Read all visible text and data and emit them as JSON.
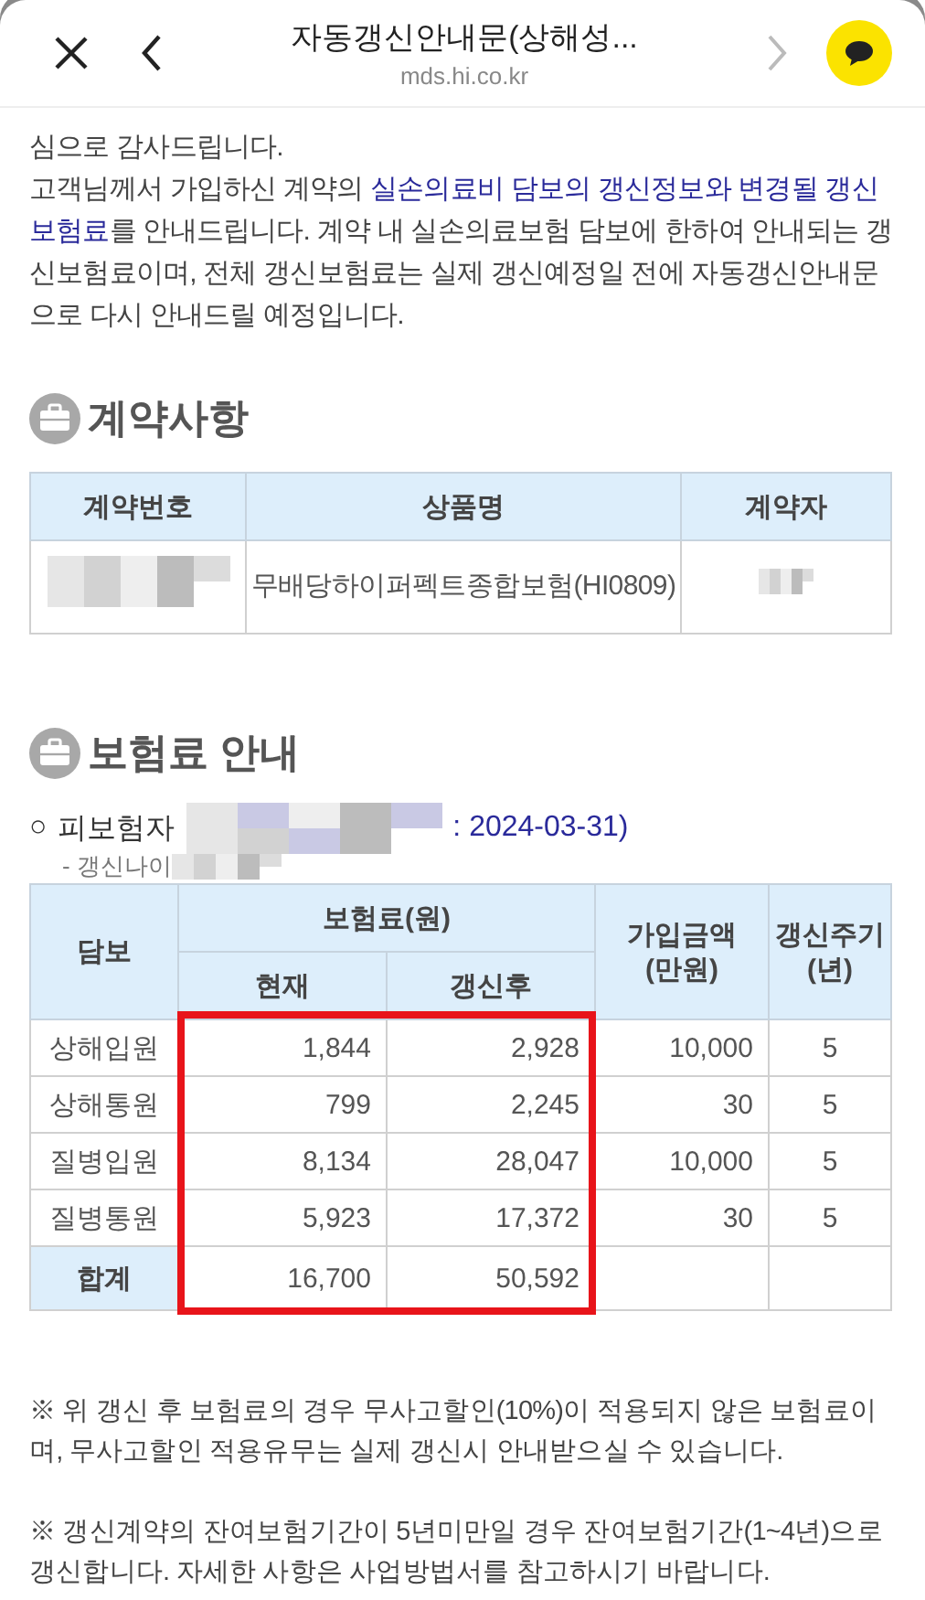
{
  "browser_bar": {
    "title": "자동갱신안내문(상해성...",
    "url": "mds.hi.co.kr"
  },
  "intro": [
    {
      "segments": [
        {
          "text": "심으로 감사드립니다.",
          "highlight": false
        }
      ]
    },
    {
      "segments": [
        {
          "text": "고객님께서 가입하신 계약의 ",
          "highlight": false
        },
        {
          "text": "실손의료비 담보의 갱신정보와 변경될 갱신보험료",
          "highlight": true
        },
        {
          "text": "를 안내드립니다. 계약 내 실손의료보험 담보에 한하여 안내되는 갱신보험료이며, 전체 갱신보험료는 실제 갱신예정일 전에 자동갱신안내문으로 다시 안내드릴 예정입니다.",
          "highlight": false
        }
      ]
    }
  ],
  "contract": {
    "title": "계약사항",
    "columns": [
      "계약번호",
      "상품명",
      "계약자"
    ],
    "row": [
      {
        "kind": "redacted"
      },
      {
        "kind": "text",
        "text": "무배당하이퍼펙트종합보험(HI0809)"
      },
      {
        "kind": "redacted"
      }
    ]
  },
  "premium": {
    "title": "보험료 안내",
    "bullet": "○",
    "insured_label": "피보험자",
    "insured_tail": ": 2024-03-31)",
    "sub_line": "- 갱신나이",
    "table": {
      "columns": {
        "coverage": "담보",
        "premium": "보험료(원)",
        "current": "현재",
        "renewed": "갱신후",
        "amount": "가입금액\n(만원)",
        "cycle": "갱신주기\n(년)"
      },
      "rows": [
        {
          "coverage": "상해입원",
          "current": "1,844",
          "renewed": "2,928",
          "amount": "10,000",
          "cycle": "5"
        },
        {
          "coverage": "상해통원",
          "current": "799",
          "renewed": "2,245",
          "amount": "30",
          "cycle": "5"
        },
        {
          "coverage": "질병입원",
          "current": "8,134",
          "renewed": "28,047",
          "amount": "10,000",
          "cycle": "5"
        },
        {
          "coverage": "질병통원",
          "current": "5,923",
          "renewed": "17,372",
          "amount": "30",
          "cycle": "5"
        }
      ],
      "total": {
        "coverage": "합계",
        "current": "16,700",
        "renewed": "50,592"
      },
      "highlighted": true
    }
  },
  "notes": [
    "※ 위 갱신 후 보험료의 경우 무사고할인(10%)이 적용되지 않은 보험료이며, 무사고할인 적용유무는 실제 갱신시 안내받으실 수 있습니다.",
    "※ 갱신계약의 잔여보험기간이 5년미만일 경우 잔여보험기간(1~4년)으로 갱신합니다. 자세한 사항은 사업방법서를 참고하시기 바랍니다."
  ]
}
